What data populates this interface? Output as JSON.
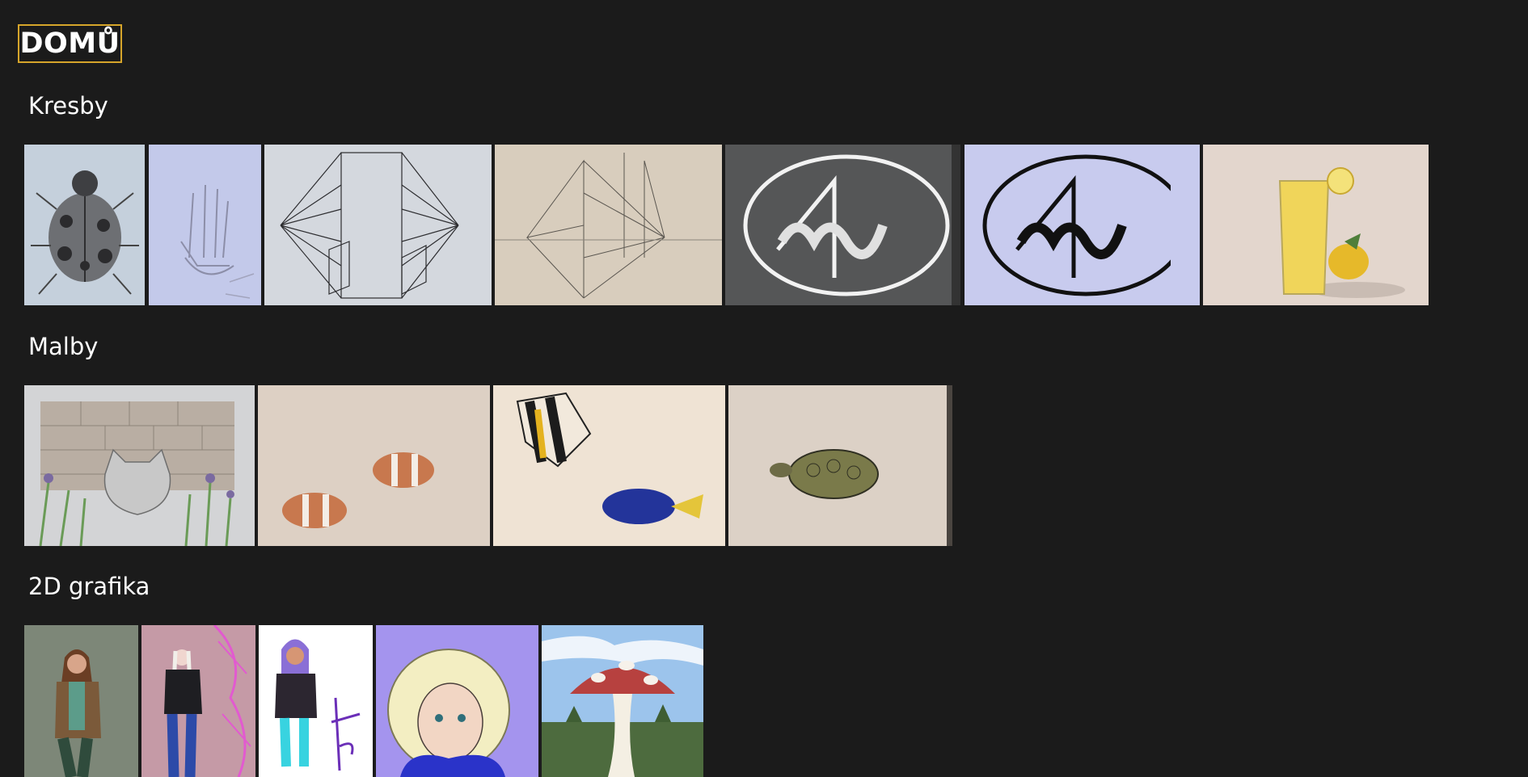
{
  "nav": {
    "home_label": "DOMŮ"
  },
  "sections": [
    {
      "title": "Kresby",
      "item_count": 7
    },
    {
      "title": "Malby",
      "item_count": 4
    },
    {
      "title": "2D grafika",
      "item_count": 5
    }
  ],
  "colors": {
    "background": "#1b1b1b",
    "home_border": "#d6a52a",
    "text": "#ffffff"
  }
}
